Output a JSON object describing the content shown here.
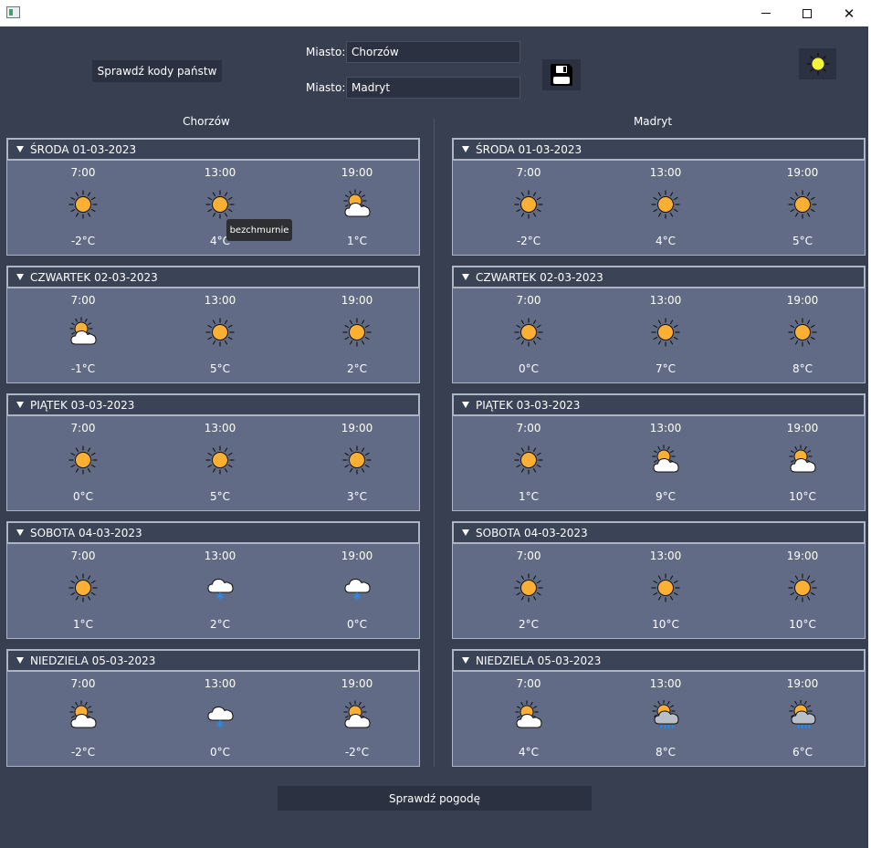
{
  "window": {
    "title": ""
  },
  "header": {
    "codes_button": "Sprawdź kody państw",
    "city_label_1": "Miasto:",
    "city_value_1": "Chorzów",
    "city_label_2": "Miasto:",
    "city_value_2": "Madryt",
    "save_icon": "floppy-disk-icon",
    "theme_icon": "sun-icon"
  },
  "check_button": "Sprawdź pogodę",
  "tooltip": "bezchmurnie",
  "columns": [
    {
      "city": "Chorzów",
      "days": [
        {
          "label": "ŚRODA 01-03-2023",
          "slots": [
            {
              "time": "7:00",
              "icon": "sunny",
              "temp": "-2°C"
            },
            {
              "time": "13:00",
              "icon": "sunny",
              "temp": "4°C"
            },
            {
              "time": "19:00",
              "icon": "partly-cloudy",
              "temp": "1°C"
            }
          ]
        },
        {
          "label": "CZWARTEK 02-03-2023",
          "slots": [
            {
              "time": "7:00",
              "icon": "partly-cloudy",
              "temp": "-1°C"
            },
            {
              "time": "13:00",
              "icon": "sunny",
              "temp": "5°C"
            },
            {
              "time": "19:00",
              "icon": "sunny",
              "temp": "2°C"
            }
          ]
        },
        {
          "label": "PIĄTEK 03-03-2023",
          "slots": [
            {
              "time": "7:00",
              "icon": "sunny",
              "temp": "0°C"
            },
            {
              "time": "13:00",
              "icon": "sunny",
              "temp": "5°C"
            },
            {
              "time": "19:00",
              "icon": "sunny",
              "temp": "3°C"
            }
          ]
        },
        {
          "label": "SOBOTA 04-03-2023",
          "slots": [
            {
              "time": "7:00",
              "icon": "sunny",
              "temp": "1°C"
            },
            {
              "time": "13:00",
              "icon": "snow",
              "temp": "2°C"
            },
            {
              "time": "19:00",
              "icon": "snow",
              "temp": "0°C"
            }
          ]
        },
        {
          "label": "NIEDZIELA 05-03-2023",
          "slots": [
            {
              "time": "7:00",
              "icon": "partly-cloudy",
              "temp": "-2°C"
            },
            {
              "time": "13:00",
              "icon": "snow",
              "temp": "0°C"
            },
            {
              "time": "19:00",
              "icon": "partly-cloudy",
              "temp": "-2°C"
            }
          ]
        }
      ]
    },
    {
      "city": "Madryt",
      "days": [
        {
          "label": "ŚRODA 01-03-2023",
          "slots": [
            {
              "time": "7:00",
              "icon": "sunny",
              "temp": "-2°C"
            },
            {
              "time": "13:00",
              "icon": "sunny",
              "temp": "4°C"
            },
            {
              "time": "19:00",
              "icon": "sunny",
              "temp": "5°C"
            }
          ]
        },
        {
          "label": "CZWARTEK 02-03-2023",
          "slots": [
            {
              "time": "7:00",
              "icon": "sunny",
              "temp": "0°C"
            },
            {
              "time": "13:00",
              "icon": "sunny",
              "temp": "7°C"
            },
            {
              "time": "19:00",
              "icon": "sunny",
              "temp": "8°C"
            }
          ]
        },
        {
          "label": "PIĄTEK 03-03-2023",
          "slots": [
            {
              "time": "7:00",
              "icon": "sunny",
              "temp": "1°C"
            },
            {
              "time": "13:00",
              "icon": "partly-cloudy",
              "temp": "9°C"
            },
            {
              "time": "19:00",
              "icon": "partly-cloudy",
              "temp": "10°C"
            }
          ]
        },
        {
          "label": "SOBOTA 04-03-2023",
          "slots": [
            {
              "time": "7:00",
              "icon": "sunny",
              "temp": "2°C"
            },
            {
              "time": "13:00",
              "icon": "sunny",
              "temp": "10°C"
            },
            {
              "time": "19:00",
              "icon": "sunny",
              "temp": "10°C"
            }
          ]
        },
        {
          "label": "NIEDZIELA 05-03-2023",
          "slots": [
            {
              "time": "7:00",
              "icon": "partly-cloudy",
              "temp": "4°C"
            },
            {
              "time": "13:00",
              "icon": "sun-rain",
              "temp": "8°C"
            },
            {
              "time": "19:00",
              "icon": "sun-rain",
              "temp": "6°C"
            }
          ]
        }
      ]
    }
  ],
  "colors": {
    "background": "#373f51",
    "group": "#616b85",
    "header": "#3b4356",
    "button": "#2b3140",
    "sun": "#fbb034"
  }
}
